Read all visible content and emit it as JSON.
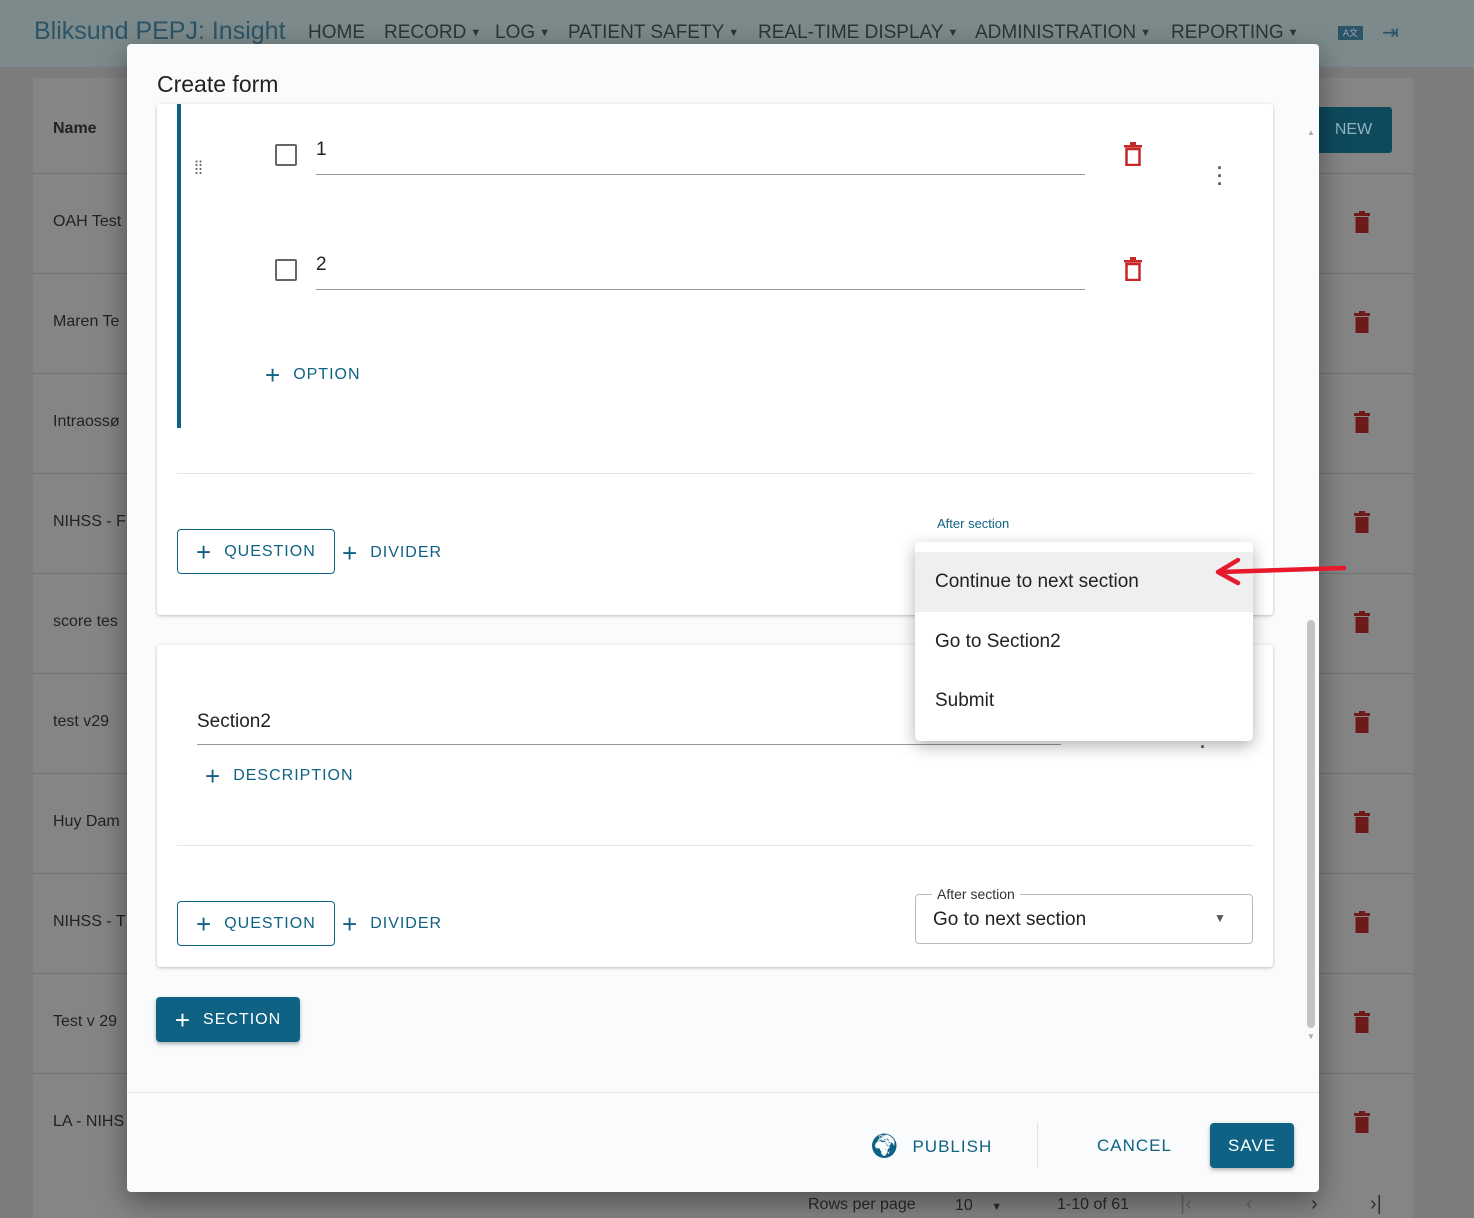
{
  "header": {
    "brand": "Bliksund PEPJ: Insight",
    "nav": [
      {
        "label": "HOME",
        "dropdown": false
      },
      {
        "label": "RECORD",
        "dropdown": true
      },
      {
        "label": "LOG",
        "dropdown": true
      },
      {
        "label": "PATIENT SAFETY",
        "dropdown": true
      },
      {
        "label": "REAL-TIME DISPLAY",
        "dropdown": true
      },
      {
        "label": "ADMINISTRATION",
        "dropdown": true
      },
      {
        "label": "REPORTING",
        "dropdown": true
      }
    ],
    "icons": [
      "translate-icon",
      "logout-icon"
    ]
  },
  "table": {
    "column_name": "Name",
    "new_label": "NEW",
    "rows": [
      "OAH Test",
      "Maren Te",
      "Intraossø",
      "NIHSS - F",
      "score tes",
      "test v29",
      "Huy Dam",
      "NIHSS - T",
      "Test v 29",
      "LA - NIHS"
    ],
    "rows_per_page_label": "Rows per page",
    "rows_per_page": "10",
    "range": "1-10 of 61"
  },
  "modal": {
    "title": "Create form",
    "section1": {
      "options": [
        {
          "value": "1",
          "checked": false
        },
        {
          "value": "2",
          "checked": false
        }
      ],
      "add_option": "OPTION",
      "add_question": "QUESTION",
      "add_divider": "DIVIDER",
      "after_label": "After section"
    },
    "section2": {
      "title": "Section2",
      "add_description": "DESCRIPTION",
      "add_question": "QUESTION",
      "add_divider": "DIVIDER",
      "after_label": "After section",
      "after_value": "Go to next section"
    },
    "add_section": "SECTION",
    "footer": {
      "publish": "PUBLISH",
      "cancel": "CANCEL",
      "save": "SAVE"
    }
  },
  "dropdown_menu": {
    "items": [
      "Continue to next section",
      "Go to Section2",
      "Submit"
    ],
    "highlighted": 0
  },
  "colors": {
    "primary": "#0f6283",
    "danger": "#c62828",
    "annotation_arrow": "#e8192c"
  }
}
